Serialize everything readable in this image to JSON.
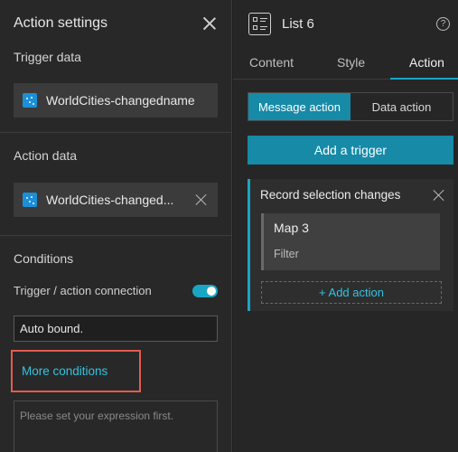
{
  "left_panel": {
    "title": "Action settings",
    "trigger_data": {
      "label": "Trigger data",
      "datasource": "WorldCities-changedname"
    },
    "action_data": {
      "label": "Action data",
      "datasource": "WorldCities-changed..."
    },
    "conditions": {
      "label": "Conditions",
      "connection_label": "Trigger / action connection",
      "connection_enabled": true,
      "auto_bound_value": "Auto bound.",
      "more_conditions_label": "More conditions",
      "expression_placeholder": "Please set your expression first."
    }
  },
  "right_panel": {
    "widget_title": "List 6",
    "help_glyph": "?",
    "tabs": [
      {
        "label": "Content",
        "active": false
      },
      {
        "label": "Style",
        "active": false
      },
      {
        "label": "Action",
        "active": true
      }
    ],
    "segments": [
      {
        "label": "Message action",
        "active": true
      },
      {
        "label": "Data action",
        "active": false
      }
    ],
    "add_trigger_label": "Add a trigger",
    "trigger_card": {
      "title": "Record selection changes",
      "actions": [
        {
          "target": "Map 3",
          "type": "Filter"
        }
      ],
      "add_action_label": "+ Add action"
    }
  },
  "colors": {
    "accent": "#1aa5c4",
    "button": "#168aa7",
    "link": "#35c3e0",
    "highlight_border": "#e25c4f",
    "datasource_icon": "#1c8fd8"
  }
}
